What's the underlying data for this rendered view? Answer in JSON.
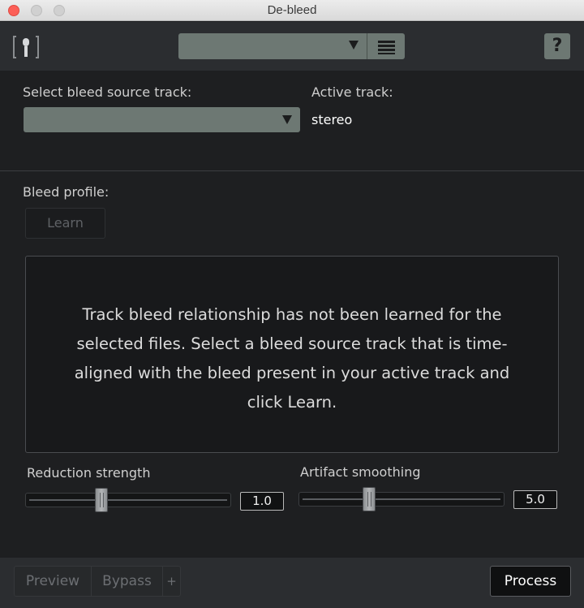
{
  "window": {
    "title": "De-bleed"
  },
  "toolbar": {
    "preset_value": "",
    "help_label": "?"
  },
  "source": {
    "label": "Select bleed source track:",
    "selected": ""
  },
  "active": {
    "label": "Active track:",
    "value": "stereo"
  },
  "profile": {
    "label": "Bleed profile:",
    "learn_label": "Learn"
  },
  "message": "Track bleed relationship has not been learned for the selected files. Select a bleed source track that is time-aligned with the bleed present in your active track and click Learn.",
  "sliders": [
    {
      "label": "Reduction strength",
      "value": "1.0",
      "fraction": 0.36
    },
    {
      "label": "Artifact smoothing",
      "value": "5.0",
      "fraction": 0.33
    }
  ],
  "footer": {
    "preview_label": "Preview",
    "bypass_label": "Bypass",
    "add_label": "+",
    "process_label": "Process"
  },
  "colors": {
    "control": "#6d7873",
    "panel": "#1e1f21",
    "close": "#fc5f57"
  },
  "icons": [
    "microphone-icon",
    "dropdown-arrow-icon",
    "list-menu-icon",
    "help-icon"
  ]
}
